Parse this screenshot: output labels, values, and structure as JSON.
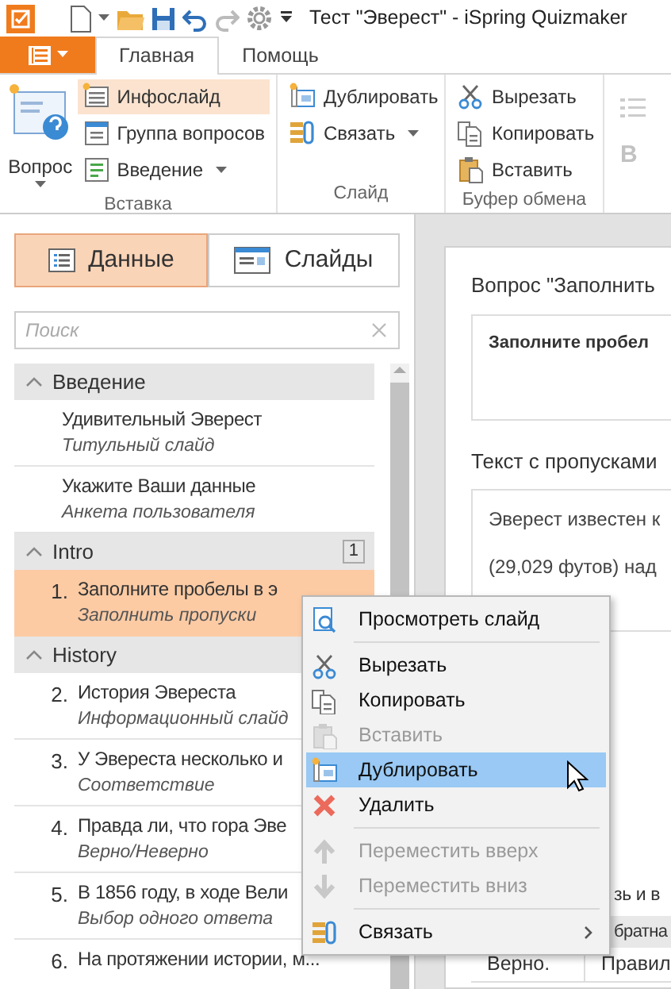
{
  "window": {
    "title": "Тест \"Эверест\" - iSpring Quizmaker"
  },
  "ribbon_tabs": [
    {
      "label": "Главная",
      "selected": true
    },
    {
      "label": "Помощь",
      "selected": false
    }
  ],
  "ribbon": {
    "groups": [
      {
        "label": "Вставка",
        "large": {
          "label": "Вопрос",
          "dropdown": true
        },
        "buttons": [
          {
            "label": "Инфослайд",
            "highlighted": true,
            "dropdown": false
          },
          {
            "label": "Группа вопросов",
            "highlighted": false,
            "dropdown": false
          },
          {
            "label": "Введение",
            "highlighted": false,
            "dropdown": true
          }
        ]
      },
      {
        "label": "Слайд",
        "buttons": [
          {
            "label": "Дублировать",
            "highlighted": false,
            "dropdown": false
          },
          {
            "label": "Связать",
            "highlighted": false,
            "dropdown": true
          }
        ]
      },
      {
        "label": "Буфер обмена",
        "buttons": [
          {
            "label": "Вырезать",
            "highlighted": false,
            "dropdown": false
          },
          {
            "label": "Копировать",
            "highlighted": false,
            "dropdown": false
          },
          {
            "label": "Вставить",
            "highlighted": false,
            "dropdown": false
          }
        ]
      }
    ],
    "cut_group": {
      "bold_button": "B"
    }
  },
  "view_switch": [
    {
      "label": "Данные",
      "selected": true
    },
    {
      "label": "Слайды",
      "selected": false
    }
  ],
  "search": {
    "placeholder": "Поиск"
  },
  "outline": [
    {
      "title": "Введение",
      "expanded": true,
      "items": [
        {
          "title": "Удивительный Эверест",
          "subtitle": "Титульный слайд",
          "selected": false
        },
        {
          "title": "Укажите Ваши данные",
          "subtitle": "Анкета пользователя",
          "selected": false
        }
      ]
    },
    {
      "title": "Intro",
      "expanded": true,
      "badge": "1",
      "items": [
        {
          "number": "1.",
          "title": "Заполните пробелы в э",
          "subtitle": "Заполнить пропуски",
          "selected": true
        }
      ]
    },
    {
      "title": "History",
      "expanded": true,
      "items": [
        {
          "number": "2.",
          "title": "История Эвереста",
          "subtitle": "Информационный слайд",
          "selected": false
        },
        {
          "number": "3.",
          "title": "У Эвереста несколько и",
          "subtitle": "Соответствие",
          "selected": false
        },
        {
          "number": "4.",
          "title": "Правда ли, что гора Эве",
          "subtitle": "Верно/Неверно",
          "selected": false
        },
        {
          "number": "5.",
          "title": "В 1856 году, в ходе Вели",
          "subtitle": "Выбор одного ответа",
          "selected": false
        },
        {
          "number": "6.",
          "title": "На протяжении истории, м...",
          "selected": false
        }
      ]
    }
  ],
  "editor": {
    "question_heading": "Вопрос \"Заполнить",
    "question_text": "Заполните пробел",
    "gaps_heading": "Текст с пропусками",
    "gaps_lines": [
      "Эверест известен к",
      "(29,029 футов) над"
    ],
    "section_heading": "зь и в",
    "table_header": "братна",
    "table_row": [
      "Верно.",
      "Правил"
    ]
  },
  "context_menu": [
    {
      "kind": "item",
      "label": "Просмотреть слайд",
      "disabled": false,
      "selected": false,
      "submenu": false
    },
    {
      "kind": "separator"
    },
    {
      "kind": "item",
      "label": "Вырезать",
      "disabled": false,
      "selected": false,
      "submenu": false
    },
    {
      "kind": "item",
      "label": "Копировать",
      "disabled": false,
      "selected": false,
      "submenu": false
    },
    {
      "kind": "item",
      "label": "Вставить",
      "disabled": true,
      "selected": false,
      "submenu": false
    },
    {
      "kind": "item",
      "label": "Дублировать",
      "disabled": false,
      "selected": true,
      "submenu": false
    },
    {
      "kind": "item",
      "label": "Удалить",
      "disabled": false,
      "selected": false,
      "submenu": false
    },
    {
      "kind": "separator"
    },
    {
      "kind": "item",
      "label": "Переместить вверх",
      "disabled": true,
      "selected": false,
      "submenu": false
    },
    {
      "kind": "item",
      "label": "Переместить вниз",
      "disabled": true,
      "selected": false,
      "submenu": false
    },
    {
      "kind": "separator"
    },
    {
      "kind": "item",
      "label": "Связать",
      "disabled": false,
      "selected": false,
      "submenu": true
    }
  ]
}
